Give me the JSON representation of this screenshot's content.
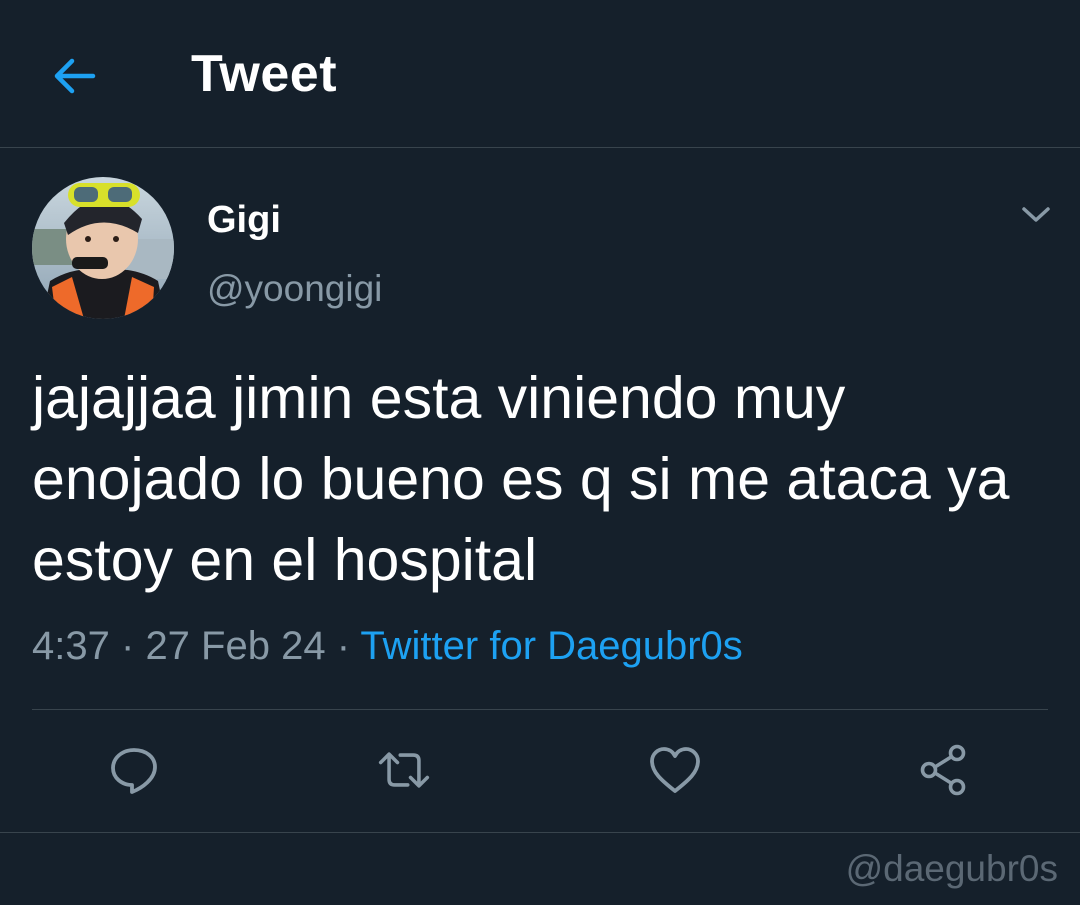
{
  "header": {
    "title": "Tweet",
    "back_icon": "arrow-left-icon"
  },
  "tweet": {
    "display_name": "Gigi",
    "handle": "@yoongigi",
    "text": "jajajjaa jimin esta viniendo muy enojado lo bueno es q si me ataca ya estoy en el hospital",
    "time": "4:37",
    "date": "27 Feb 24",
    "separator": "·",
    "source": "Twitter for Daegubr0s"
  },
  "actions": {
    "reply_icon": "reply-icon",
    "retweet_icon": "retweet-icon",
    "like_icon": "heart-icon",
    "share_icon": "share-icon"
  },
  "watermark": "@daegubr0s",
  "colors": {
    "background": "#15202b",
    "accent": "#1da1f2",
    "secondary_text": "#8899a6",
    "divider": "#38444d"
  }
}
